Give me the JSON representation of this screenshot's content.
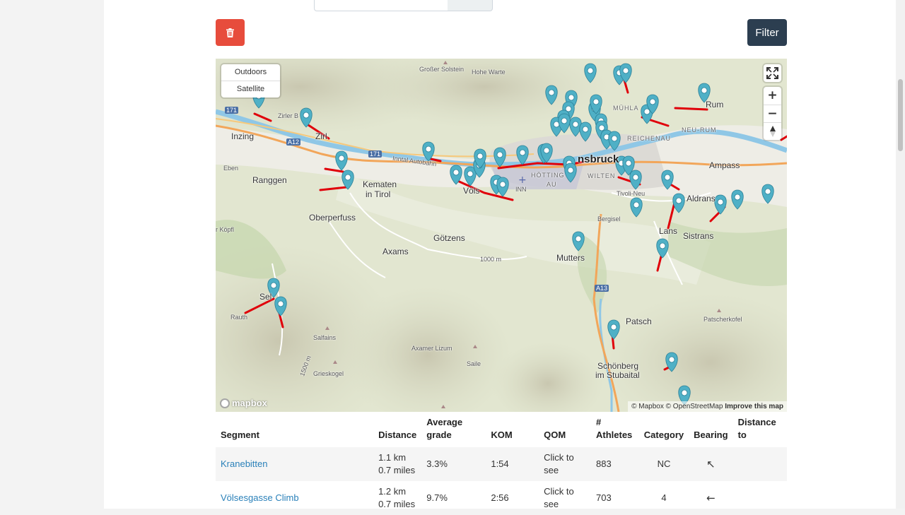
{
  "toolbar": {
    "delete_icon": "trash-icon",
    "filter_label": "Filter"
  },
  "map": {
    "layers": [
      "Outdoors",
      "Satellite"
    ],
    "controls": {
      "fullscreen_icon": "fullscreen-icon",
      "zoom_in": "+",
      "zoom_out": "−",
      "compass_icon": "compass-icon"
    },
    "attribution": {
      "mapbox": "© Mapbox",
      "osm": "© OpenStreetMap",
      "improve": "Improve this map"
    },
    "logo": "mapbox",
    "labels": {
      "grosser_solstein": "Großer Solstein",
      "hohe_warte": "Hohe Warte",
      "zirl": "Zirl",
      "zirler": "Zirler B",
      "inzing": "Inzing",
      "eben": "Eben",
      "ranggen": "Ranggen",
      "kematen": "Kematen",
      "in_tirol": "in Tirol",
      "oberperfuss": "Oberperfuss",
      "kopfl": "r Köpfl",
      "axams": "Axams",
      "gotzens": "Götzens",
      "vols": "Völs",
      "inn": "INN",
      "innsbruck": "nsbruck",
      "hotting": "HÖTTING",
      "au": "AU",
      "wilten": "WILTEN",
      "muhlau": "MÜHLA",
      "reichenau": "REICHENAU",
      "neu_rum": "NEU-RUM",
      "rum": "Rum",
      "ampass": "Ampass",
      "aldrans": "Aldrans",
      "sistrans": "Sistrans",
      "lans": "Lans",
      "tivoli": "Tivoli-Neu",
      "bergisel": "Bergisel",
      "mutters": "Mutters",
      "patsch": "Patsch",
      "patscherkofel": "Patscherkofel",
      "schonberg": "Schönberg",
      "im_stubaital": "im Stubaital",
      "sellrain": "Sel",
      "rauth": "Rauth",
      "salfains": "Salfains",
      "grieskogel": "Grieskogel",
      "axamer_lizum": "Axamer Lizum",
      "saile": "Saile",
      "inntal_autobahn": "Inntal Autobahn",
      "m1000": "1000 m",
      "m1500": "1500 m",
      "a12": "A12",
      "a13": "A13",
      "r171": "171"
    }
  },
  "table": {
    "headers": {
      "segment": "Segment",
      "distance": "Distance",
      "avg_grade": "Average grade",
      "kom": "KOM",
      "qom": "QOM",
      "athletes": "# Athletes",
      "category": "Category",
      "bearing": "Bearing",
      "distance_to": "Distance to"
    },
    "rows": [
      {
        "segment": "Kranebitten",
        "distance_km": "1.1 km",
        "distance_mi": "0.7 miles",
        "grade": "3.3%",
        "kom": "1:54",
        "qom": "Click to see",
        "athletes": "883",
        "category": "NC",
        "bearing": "↖",
        "distance_to": ""
      },
      {
        "segment": "Völsesgasse Climb",
        "distance_km": "1.2 km",
        "distance_mi": "0.7 miles",
        "grade": "9.7%",
        "kom": "2:56",
        "qom": "Click to see",
        "athletes": "703",
        "category": "4",
        "bearing": "←",
        "distance_to": ""
      }
    ]
  },
  "colors": {
    "marker": "#4fb0c6",
    "segment_line": "#e0000a",
    "delete_btn": "#e74c3c",
    "filter_btn": "#2c3e50",
    "link": "#2980b9",
    "river": "#8fc7e6",
    "highway": "#f2a65a"
  }
}
